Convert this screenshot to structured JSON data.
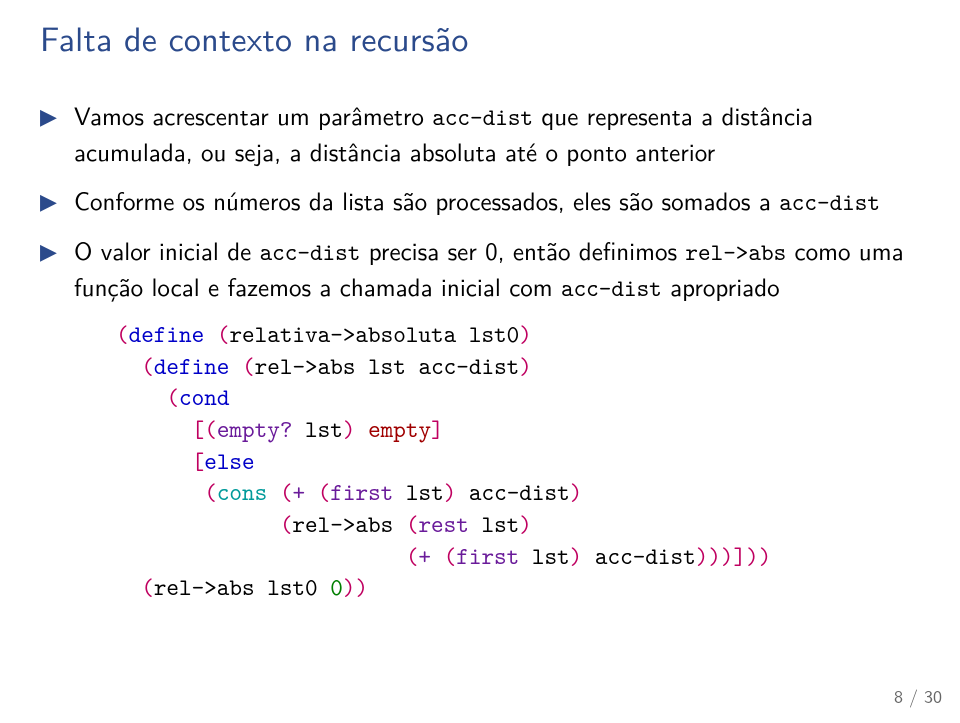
{
  "title": "Falta de contexto na recursão",
  "bullets": {
    "b1a": "Vamos acrescentar um parâmetro ",
    "b1b": "acc-dist",
    "b1c": " que representa a distância acumulada, ou seja, a distância absoluta até o ponto anterior",
    "b2a": "Conforme os números da lista são processados, eles são somados a ",
    "b2b": "acc-dist",
    "b3a": "O valor inicial de ",
    "b3b": "acc-dist",
    "b3c": " precisa ser 0, então definimos ",
    "b3d": "rel->abs",
    "b3e": " como uma função local e fazemos a chamada inicial com ",
    "b3f": "acc-dist",
    "b3g": " apropriado"
  },
  "code": {
    "tok": {
      "lp": "(",
      "rp": ")",
      "lb": "[",
      "rb": "]",
      "define": "define",
      "cond": "cond",
      "emptyq": "empty?",
      "empty": "empty",
      "else": "else",
      "cons": "cons",
      "plus": "+",
      "first": "first",
      "rest": "rest",
      "relabs": "rel->abs",
      "relabs_arrow": "relativa->absoluta",
      "lst": "lst",
      "lst0": "lst0",
      "accdist": "acc-dist",
      "zero": "0",
      "sp": " "
    }
  },
  "pagenum": "8 / 30"
}
